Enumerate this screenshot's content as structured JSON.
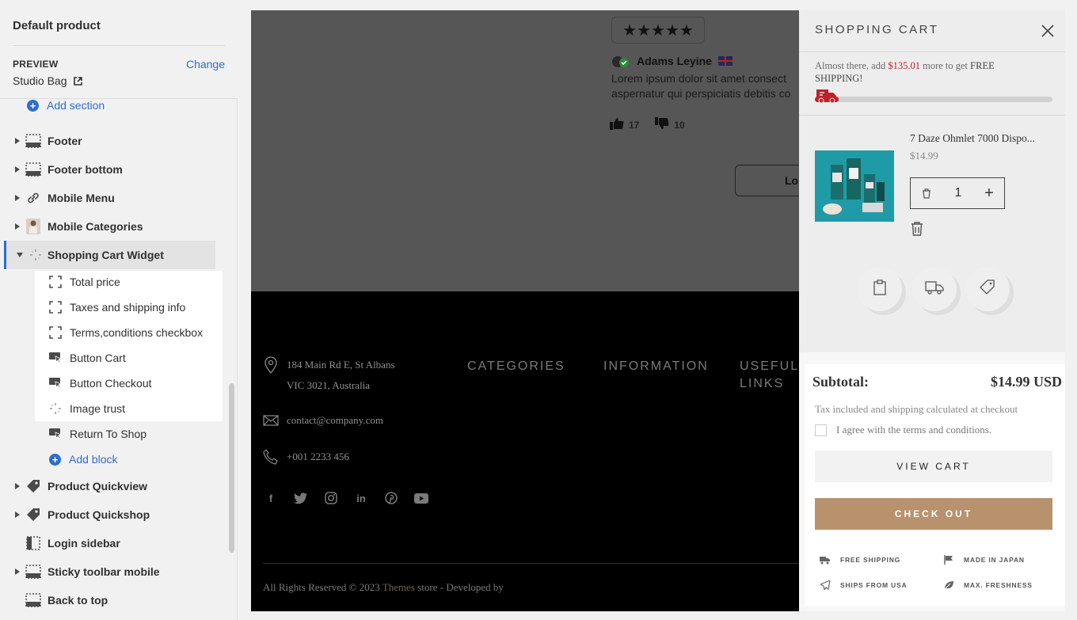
{
  "editor": {
    "title": "Default product",
    "preview_label": "PREVIEW",
    "change_label": "Change",
    "preview_product": "Studio Bag",
    "add_section": "Add section",
    "sections": [
      {
        "label": "Footer",
        "icon": "layout-footer-icon"
      },
      {
        "label": "Footer bottom",
        "icon": "layout-footer-icon"
      },
      {
        "label": "Mobile Menu",
        "icon": "link-icon"
      },
      {
        "label": "Mobile Categories",
        "icon": "image-thumbnail-icon"
      },
      {
        "label": "Shopping Cart Widget",
        "icon": "loading-icon"
      },
      {
        "label": "Product Quickview",
        "icon": "tag-icon"
      },
      {
        "label": "Product Quickshop",
        "icon": "tag-icon"
      },
      {
        "label": "Login sidebar",
        "icon": "sidebar-layout-icon"
      },
      {
        "label": "Sticky toolbar mobile",
        "icon": "layout-footer-icon"
      },
      {
        "label": "Back to top",
        "icon": "layout-footer-icon"
      }
    ],
    "blocks": [
      {
        "label": "Total price",
        "icon": "block-frame-icon"
      },
      {
        "label": "Taxes and shipping info",
        "icon": "block-frame-icon"
      },
      {
        "label": "Terms,conditions checkbox",
        "icon": "block-frame-icon"
      },
      {
        "label": "Button Cart",
        "icon": "button-press-icon"
      },
      {
        "label": "Button Checkout",
        "icon": "button-press-icon"
      },
      {
        "label": "Image trust",
        "icon": "loading-icon"
      },
      {
        "label": "Return To Shop",
        "icon": "button-press-icon"
      }
    ],
    "add_block": "Add block"
  },
  "preview": {
    "review": {
      "stars": "★★★★★",
      "rating": 5,
      "author": "Adams Leyine",
      "text_line1": "Lorem ipsum dolor sit amet consect",
      "text_line2": "aspernatur qui perspiciatis debitis co",
      "likes": "17",
      "dislikes": "10",
      "load_more": "Lo"
    },
    "footer": {
      "address_line1": "184 Main Rd E, St Albans",
      "address_line2": "VIC 3021, Australia",
      "email": "contact@company.com",
      "phone": "+001 2233 456",
      "col_categories": "CATEGORIES",
      "col_information": "INFORMATION",
      "col_useful_1": "USEFUL",
      "col_useful_2": "LINKS",
      "copyright_prefix": "All Rights Reserved © 2023 ",
      "copyright_brand": "Themes",
      "copyright_suffix": " store - Developed by"
    }
  },
  "cart": {
    "title": "SHOPPING CART",
    "ship_prefix": "Almost there, add ",
    "ship_amount": "$135.01",
    "ship_middle": " more to get ",
    "ship_free": "FREE SHIPPING!",
    "progress_fraction": 0.1,
    "item": {
      "name": "7 Daze Ohmlet 7000 Dispo...",
      "price": "$14.99",
      "quantity": "1"
    },
    "subtotal_label": "Subtotal:",
    "subtotal_value": "$14.99 USD",
    "tax_note": "Tax included and shipping calculated at checkout",
    "terms": "I agree with the terms and conditions.",
    "view_cart": "VIEW CART",
    "checkout": "CHECK OUT",
    "trust": [
      {
        "label": "FREE SHIPPING",
        "icon": "truck-icon"
      },
      {
        "label": "MADE IN JAPAN",
        "icon": "flag-icon"
      },
      {
        "label": "SHIPS FROM USA",
        "icon": "paper-plane-icon"
      },
      {
        "label": "MAX. FRESHNESS",
        "icon": "leaf-icon"
      }
    ],
    "colors": {
      "accent": "#c0202b",
      "checkout_bg": "#b8926d"
    }
  }
}
